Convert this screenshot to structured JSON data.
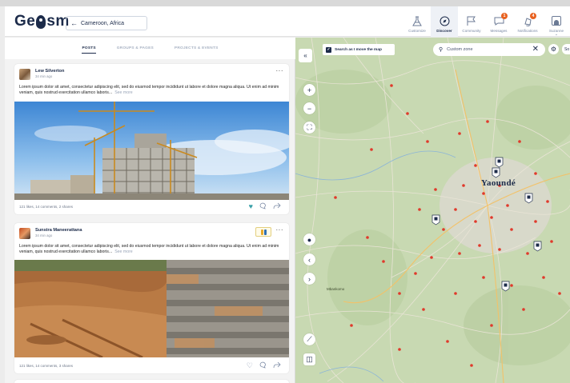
{
  "header": {
    "logo_text_left": "Ge",
    "logo_text_right": "sm",
    "location": "Cameroon, Africa",
    "nav": [
      {
        "label": "Customize",
        "icon": "customize-icon"
      },
      {
        "label": "Discover",
        "icon": "compass-icon",
        "active": true
      },
      {
        "label": "Community",
        "icon": "flag-icon"
      },
      {
        "label": "Messages",
        "icon": "chat-icon",
        "badge": "1"
      },
      {
        "label": "Notifications",
        "icon": "bell-icon",
        "badge": "4"
      },
      {
        "label": "Suzanne",
        "icon": "avatar-icon"
      }
    ]
  },
  "tabs": [
    {
      "label": "POSTS",
      "active": true
    },
    {
      "label": "GROUPS & PAGES"
    },
    {
      "label": "PROJECTS & EVENTS"
    }
  ],
  "posts": [
    {
      "author": "Lew Silverton",
      "time": "34 min ago",
      "text": "Lorem ipsum dolor sit amet, consectetur adipiscing elit, sed do eiusmod tempor incididunt ut labore et dolore magna aliqua. Ut enim ad minim veniam, quis nostrud exercitation ullamco laboris...",
      "see_more": "See more",
      "stats": "121 likes, 14 comments, 2 shares",
      "liked": true
    },
    {
      "author": "Sunstra Maneerattana",
      "time": "34 min ago",
      "text": "Lorem ipsum dolor sit amet, consectetur adipiscing elit, sed do eiusmod tempor incididunt ut labore et dolore magna aliqua. Ut enim ad minim veniam, quis nostrud exercitation ullamco laboris...",
      "see_more": "See more",
      "stats": "121 likes, 14 comments, 3 shares",
      "liked": false
    }
  ],
  "map": {
    "search_move_label": "Search as I move the map",
    "search_move_checked": true,
    "zone_placeholder": "Custom zone",
    "sort_label": "So",
    "city_label": "Yaoundé",
    "small_label": "Mbankomo",
    "marker_color": "#e0392b"
  },
  "colors": {
    "brand": "#1c2b4a",
    "badge": "#e8611f",
    "liked": "#3aa0a8"
  }
}
